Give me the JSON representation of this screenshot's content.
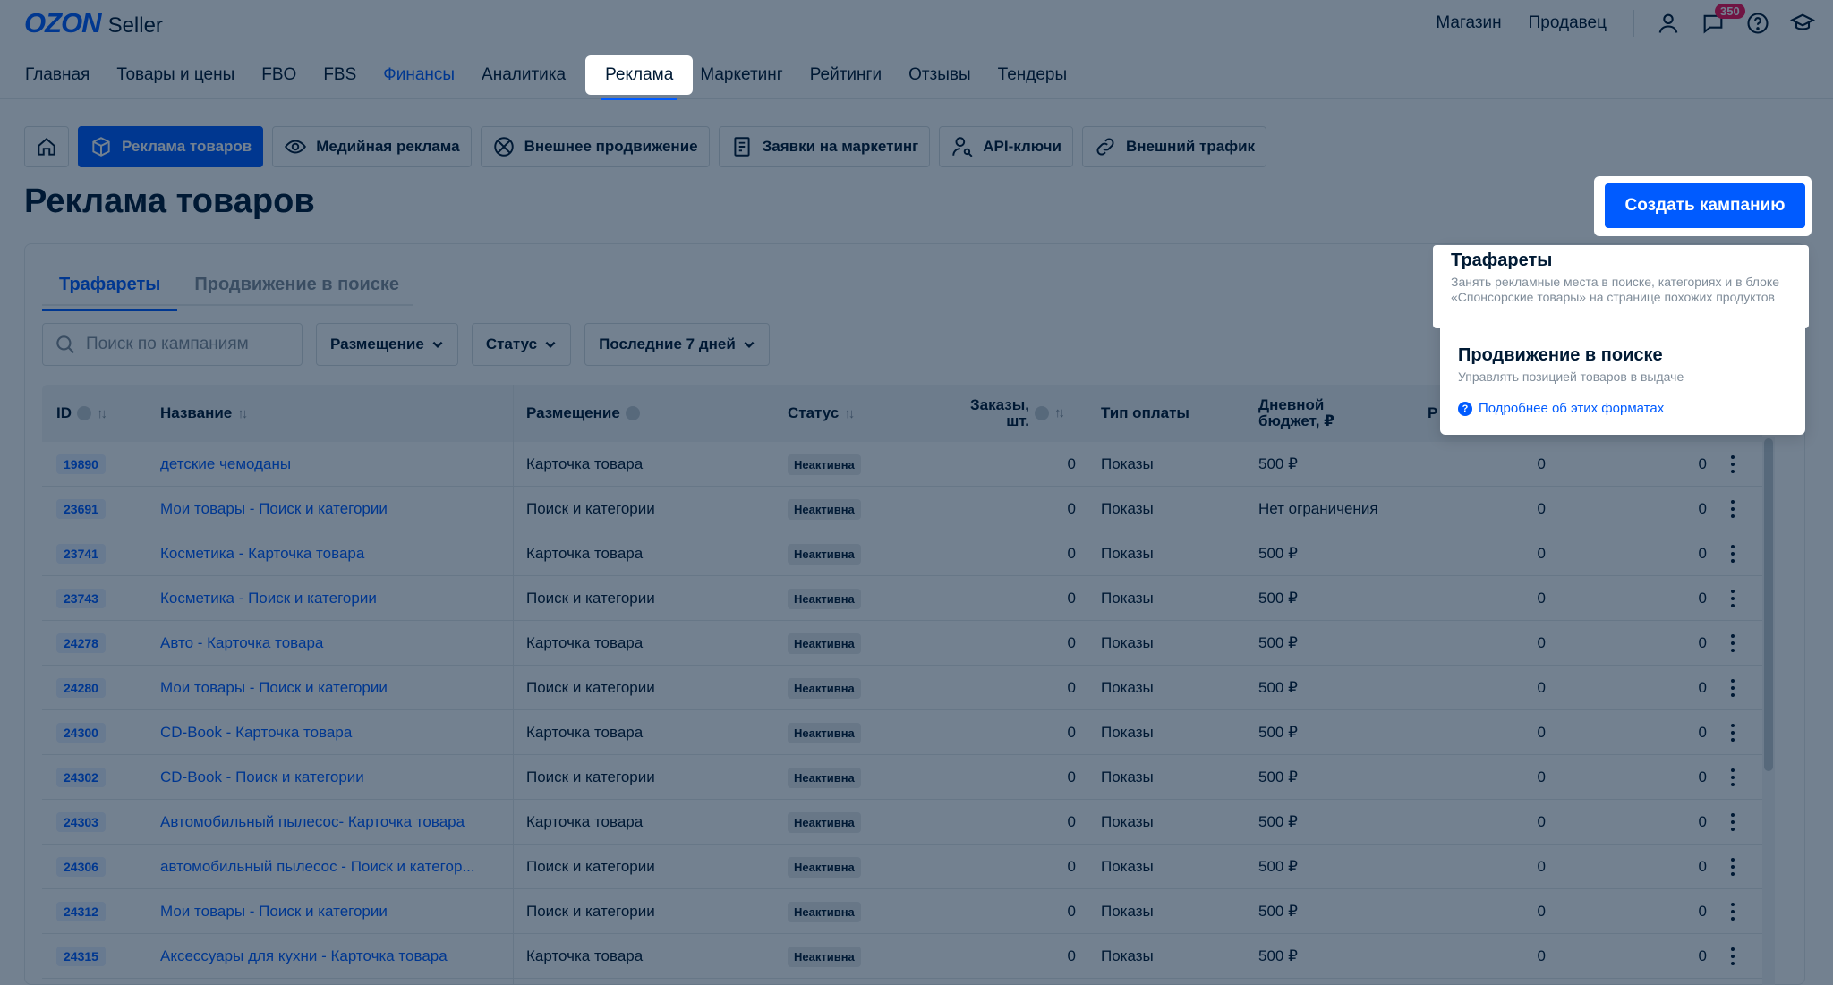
{
  "header": {
    "logo_brand": "OZON",
    "logo_product": "Seller",
    "links": [
      "Магазин",
      "Продавец"
    ],
    "notifications_count": "350"
  },
  "main_nav": [
    "Главная",
    "Товары и цены",
    "FBO",
    "FBS",
    "Финансы",
    "Аналитика",
    "Реклама",
    "Маркетинг",
    "Рейтинги",
    "Отзывы",
    "Тендеры"
  ],
  "sub_nav": [
    "Реклама товаров",
    "Медийная реклама",
    "Внешнее продвижение",
    "Заявки на маркетинг",
    "API-ключи",
    "Внешний трафик"
  ],
  "page_title": "Реклама товаров",
  "create_button": "Создать кампанию",
  "tabs": [
    "Трафареты",
    "Продвижение в поиске"
  ],
  "search_placeholder": "Поиск по кампаниям",
  "filters": [
    "Размещение",
    "Статус",
    "Последние 7 дней"
  ],
  "columns": {
    "id": "ID",
    "name": "Название",
    "placement": "Размещение",
    "status": "Статус",
    "orders_1": "Заказы,",
    "orders_2": "шт.",
    "payment": "Тип оплаты",
    "budget_1": "Дневной",
    "budget_2": "бюджет, ₽",
    "extra": "Р"
  },
  "rows": [
    {
      "id": "19890",
      "name": "детские чемоданы",
      "placement": "Карточка товара",
      "status": "Неактивна",
      "orders": "0",
      "payment": "Показы",
      "budget": "500 ₽",
      "c1": "0",
      "c2": "0"
    },
    {
      "id": "23691",
      "name": "Мои товары - Поиск и категории",
      "placement": "Поиск и категории",
      "status": "Неактивна",
      "orders": "0",
      "payment": "Показы",
      "budget": "Нет ограничения",
      "c1": "0",
      "c2": "0"
    },
    {
      "id": "23741",
      "name": "Косметика - Карточка товара",
      "placement": "Карточка товара",
      "status": "Неактивна",
      "orders": "0",
      "payment": "Показы",
      "budget": "500 ₽",
      "c1": "0",
      "c2": "0"
    },
    {
      "id": "23743",
      "name": "Косметика - Поиск и категории",
      "placement": "Поиск и категории",
      "status": "Неактивна",
      "orders": "0",
      "payment": "Показы",
      "budget": "500 ₽",
      "c1": "0",
      "c2": "0"
    },
    {
      "id": "24278",
      "name": "Авто - Карточка товара",
      "placement": "Карточка товара",
      "status": "Неактивна",
      "orders": "0",
      "payment": "Показы",
      "budget": "500 ₽",
      "c1": "0",
      "c2": "0"
    },
    {
      "id": "24280",
      "name": "Мои товары - Поиск и категории",
      "placement": "Поиск и категории",
      "status": "Неактивна",
      "orders": "0",
      "payment": "Показы",
      "budget": "500 ₽",
      "c1": "0",
      "c2": "0"
    },
    {
      "id": "24300",
      "name": "CD-Book - Карточка товара",
      "placement": "Карточка товара",
      "status": "Неактивна",
      "orders": "0",
      "payment": "Показы",
      "budget": "500 ₽",
      "c1": "0",
      "c2": "0"
    },
    {
      "id": "24302",
      "name": "CD-Book - Поиск и категории",
      "placement": "Поиск и категории",
      "status": "Неактивна",
      "orders": "0",
      "payment": "Показы",
      "budget": "500 ₽",
      "c1": "0",
      "c2": "0"
    },
    {
      "id": "24303",
      "name": "Автомобильный пылесос- Карточка товара",
      "placement": "Карточка товара",
      "status": "Неактивна",
      "orders": "0",
      "payment": "Показы",
      "budget": "500 ₽",
      "c1": "0",
      "c2": "0"
    },
    {
      "id": "24306",
      "name": "автомобильный пылесос - Поиск и категор...",
      "placement": "Поиск и категории",
      "status": "Неактивна",
      "orders": "0",
      "payment": "Показы",
      "budget": "500 ₽",
      "c1": "0",
      "c2": "0"
    },
    {
      "id": "24312",
      "name": "Мои товары - Поиск и категории",
      "placement": "Поиск и категории",
      "status": "Неактивна",
      "orders": "0",
      "payment": "Показы",
      "budget": "500 ₽",
      "c1": "0",
      "c2": "0"
    },
    {
      "id": "24315",
      "name": "Аксессуары для кухни - Карточка товара",
      "placement": "Карточка товара",
      "status": "Неактивна",
      "orders": "0",
      "payment": "Показы",
      "budget": "500 ₽",
      "c1": "0",
      "c2": "0"
    }
  ],
  "create_menu": {
    "item1_title": "Трафареты",
    "item1_desc": "Занять рекламные места в поиске, категориях и в блоке «Спонсорские товары» на странице похожих продуктов",
    "item2_title": "Продвижение в поиске",
    "item2_desc": "Управлять позицией товаров в выдаче",
    "link": "Подробнее об этих форматах"
  },
  "colors": {
    "accent": "#005bff",
    "text": "#001a34",
    "muted": "#808d9a"
  }
}
